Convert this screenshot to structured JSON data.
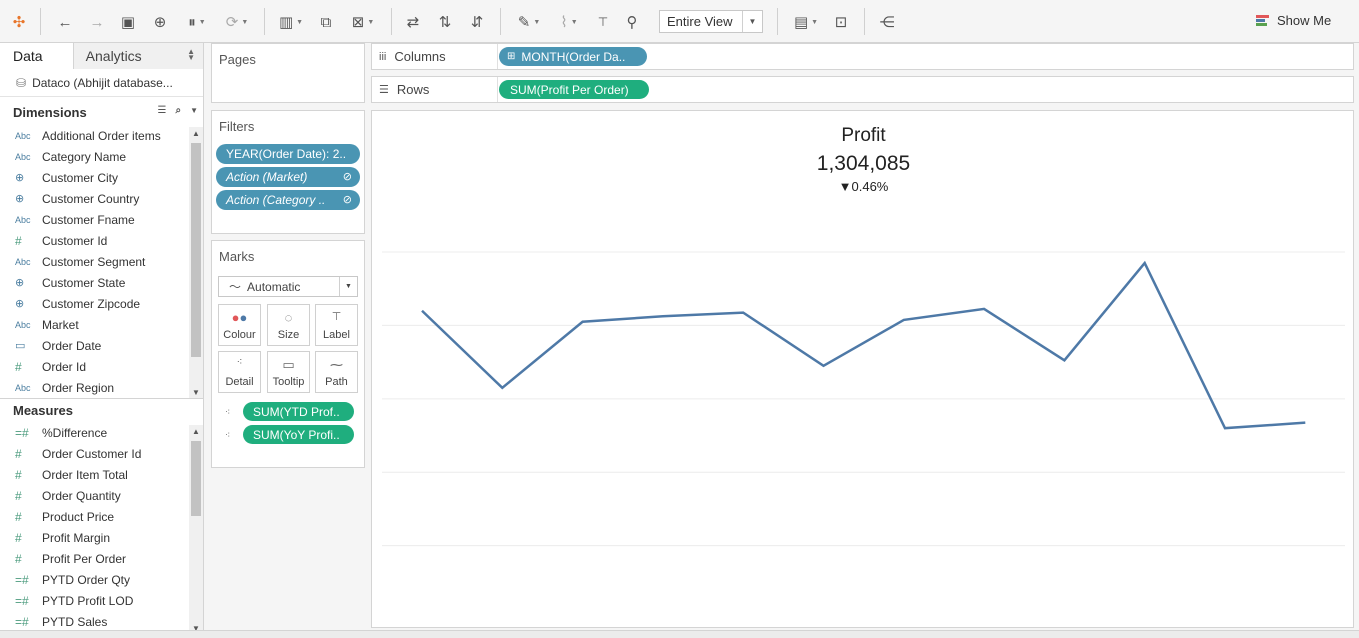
{
  "toolbar": {
    "icons": [
      "tableau-logo-icon",
      "undo-icon",
      "redo-icon",
      "save-icon",
      "new-datasource-icon",
      "pause-updates-icon",
      "refresh-icon",
      "new-worksheet-icon",
      "duplicate-icon",
      "clear-sheet-icon",
      "swap-icon",
      "sort-ascending-icon",
      "sort-descending-icon",
      "highlight-icon",
      "group-icon",
      "label-icon",
      "pin-icon",
      "chart-type-icon",
      "presentation-icon",
      "share-icon"
    ],
    "view_select": "Entire View",
    "show_me": "Show Me"
  },
  "data_pane": {
    "tab_data": "Data",
    "tab_analytics": "Analytics",
    "datasource": "Dataco (Abhijit database...",
    "dimensions_header": "Dimensions",
    "dimensions": [
      {
        "type": "Abc",
        "kind": "str",
        "label": "Additional Order items"
      },
      {
        "type": "Abc",
        "kind": "str",
        "label": "Category Name"
      },
      {
        "type": "⊕",
        "kind": "geo",
        "label": "Customer City"
      },
      {
        "type": "⊕",
        "kind": "geo",
        "label": "Customer Country"
      },
      {
        "type": "Abc",
        "kind": "str",
        "label": "Customer Fname"
      },
      {
        "type": "#",
        "kind": "num",
        "label": "Customer Id"
      },
      {
        "type": "Abc",
        "kind": "str",
        "label": "Customer Segment"
      },
      {
        "type": "⊕",
        "kind": "geo",
        "label": "Customer State"
      },
      {
        "type": "⊕",
        "kind": "geo",
        "label": "Customer Zipcode"
      },
      {
        "type": "Abc",
        "kind": "str",
        "label": "Market"
      },
      {
        "type": "▭",
        "kind": "date",
        "label": "Order Date"
      },
      {
        "type": "#",
        "kind": "num",
        "label": "Order Id"
      },
      {
        "type": "Abc",
        "kind": "str",
        "label": "Order Region"
      }
    ],
    "measures_header": "Measures",
    "measures": [
      {
        "type": "=#",
        "kind": "calcnum",
        "label": "%Difference"
      },
      {
        "type": "#",
        "kind": "num",
        "label": "Order Customer Id"
      },
      {
        "type": "#",
        "kind": "num",
        "label": "Order Item Total"
      },
      {
        "type": "#",
        "kind": "num",
        "label": "Order Quantity"
      },
      {
        "type": "#",
        "kind": "num",
        "label": "Product Price"
      },
      {
        "type": "#",
        "kind": "num",
        "label": "Profit Margin"
      },
      {
        "type": "#",
        "kind": "num",
        "label": "Profit Per Order"
      },
      {
        "type": "=#",
        "kind": "calcnum",
        "label": "PYTD Order Qty"
      },
      {
        "type": "=#",
        "kind": "calcnum",
        "label": "PYTD Profit LOD"
      },
      {
        "type": "=#",
        "kind": "calcnum",
        "label": "PYTD Sales"
      }
    ]
  },
  "pages": {
    "title": "Pages"
  },
  "filters": {
    "title": "Filters",
    "pills": [
      {
        "label": "YEAR(Order Date): 2..",
        "italic": false,
        "link": false
      },
      {
        "label": "Action (Market)",
        "italic": true,
        "link": true
      },
      {
        "label": "Action (Category ..",
        "italic": true,
        "link": true
      }
    ]
  },
  "marks": {
    "title": "Marks",
    "type": "Automatic",
    "buttons": [
      {
        "name": "colour",
        "label": "Colour"
      },
      {
        "name": "size",
        "label": "Size"
      },
      {
        "name": "label",
        "label": "Label"
      },
      {
        "name": "detail",
        "label": "Detail"
      },
      {
        "name": "tooltip",
        "label": "Tooltip"
      },
      {
        "name": "path",
        "label": "Path"
      }
    ],
    "pills": [
      "SUM(YTD Prof..",
      "SUM(YoY Profi.."
    ]
  },
  "shelves": {
    "columns_label": "Columns",
    "columns_pill": "MONTH(Order Da..",
    "rows_label": "Rows",
    "rows_pill": "SUM(Profit Per Order)"
  },
  "viz": {
    "title": "Profit",
    "value": "1,304,085",
    "change": "▼0.46%"
  },
  "chart_data": {
    "type": "line",
    "x": [
      1,
      2,
      3,
      4,
      5,
      6,
      7,
      8,
      9,
      10,
      11,
      12
    ],
    "values": [
      0.84,
      0.63,
      0.81,
      0.825,
      0.835,
      0.69,
      0.815,
      0.845,
      0.705,
      0.97,
      0.52,
      0.535
    ],
    "ylim": [
      0,
      1.15
    ],
    "grid": true,
    "line_color": "#4e79a7"
  }
}
